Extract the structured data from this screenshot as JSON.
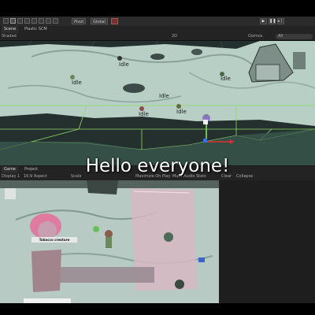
{
  "toolbar": {
    "pivot_label": "Pivot",
    "global_label": "Global",
    "play_icon": "play-icon",
    "pause_icon": "pause-icon",
    "step_icon": "step-icon"
  },
  "scene_tabs": {
    "scene": "Scene",
    "plastic": "Plastic SCM"
  },
  "scene_controls": {
    "shading": "Shaded",
    "mode_2d": "2D",
    "gizmos": "Gizmos",
    "search_placeholder": "All"
  },
  "scene_labels": [
    "Idle",
    "Idle",
    "Idle",
    "Idle",
    "Idle",
    "Idle"
  ],
  "game_tabs": {
    "game": "Game",
    "project": "Project"
  },
  "game_controls": {
    "display": "Display 1",
    "aspect": "16:9 Aspect",
    "scale": "Scale",
    "maximize": "Maximize On Play",
    "mute": "Mute Audio",
    "stats": "Stats",
    "gizmos": "Gizmos",
    "clear": "Clear",
    "collapse": "Collapse"
  },
  "game_overlay": {
    "character_label": "Tobacco creature"
  },
  "subtitle": "Hello everyone!",
  "colors": {
    "grid_green": "#8fdc6a",
    "selection_red": "#e03030",
    "scene_bg": "#b8cfc6"
  }
}
